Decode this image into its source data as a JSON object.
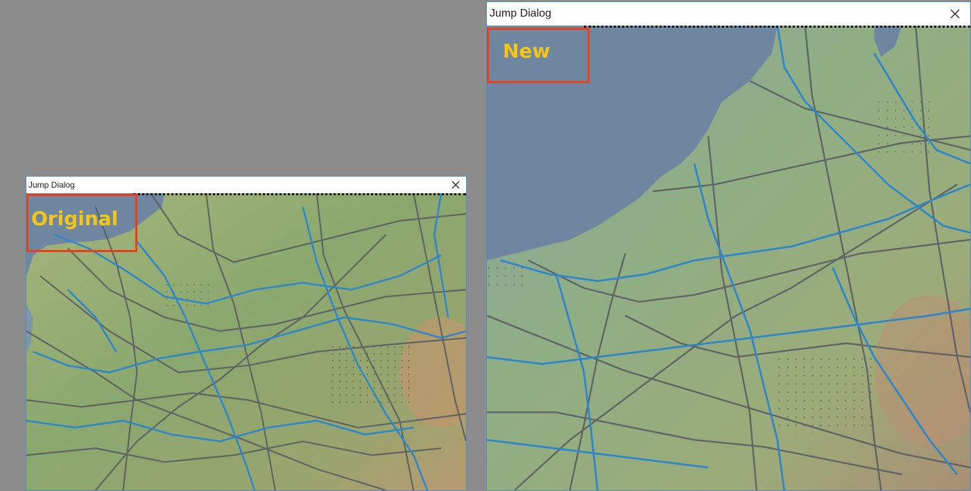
{
  "dialogs": {
    "left": {
      "title": "Jump Dialog",
      "marker_label": "Original"
    },
    "right": {
      "title": "Jump Dialog",
      "marker_label": "New"
    }
  },
  "icons": {
    "close": "close-icon"
  },
  "colors": {
    "background": "#8c8c8c",
    "dialog_border": "#4a90c8",
    "marker_border": "#e8401c",
    "marker_text": "#f5c518",
    "sea": "#6f86a0",
    "land_low": "#a9b878",
    "land_mid": "#8faa6c",
    "land_high": "#c99a6c",
    "rivers": "#2f86c8",
    "roads": "#5a5d62"
  }
}
